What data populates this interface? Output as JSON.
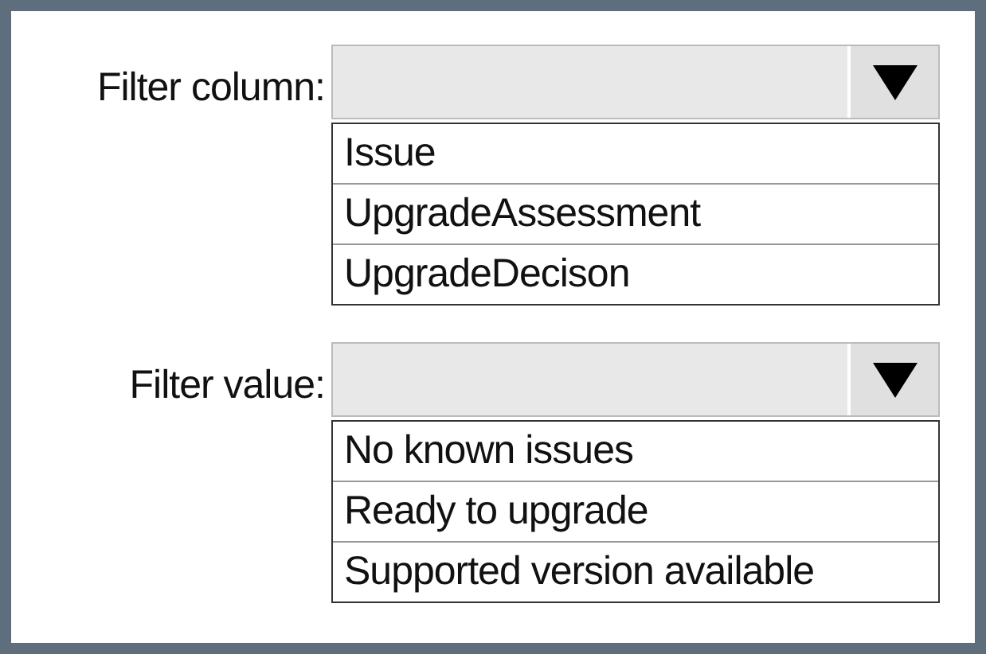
{
  "filters": [
    {
      "label": "Filter column:",
      "options": [
        "Issue",
        "UpgradeAssessment",
        "UpgradeDecison"
      ]
    },
    {
      "label": "Filter value:",
      "options": [
        "No known issues",
        "Ready to upgrade",
        "Supported version available"
      ]
    }
  ]
}
